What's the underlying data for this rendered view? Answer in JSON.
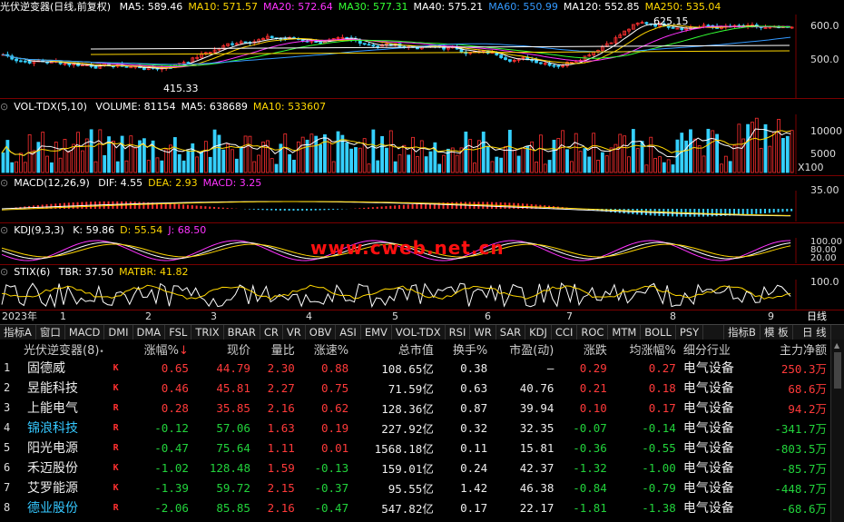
{
  "main_header": {
    "title": "光伏逆变器(日线,前复权)",
    "ma": [
      {
        "label": "MA5: 589.46",
        "color": "#ffffff"
      },
      {
        "label": "MA10: 571.57",
        "color": "#ffd700"
      },
      {
        "label": "MA20: 572.64",
        "color": "#ff33ff"
      },
      {
        "label": "MA30: 577.31",
        "color": "#33ff33"
      },
      {
        "label": "MA40: 575.21",
        "color": "#ffffff"
      },
      {
        "label": "MA60: 550.99",
        "color": "#3399ff"
      },
      {
        "label": "MA120: 552.85",
        "color": "#ffffff"
      },
      {
        "label": "MA250: 535.04",
        "color": "#ffd700"
      }
    ],
    "high_label": "625.15",
    "low_label": "415.33",
    "y_ticks": [
      "600.0",
      "500.0"
    ]
  },
  "vol_header": {
    "title": "VOL-TDX(5,10)",
    "items": [
      {
        "label": "VOLUME: 81154",
        "color": "#ffffff"
      },
      {
        "label": "MA5: 638689",
        "color": "#ffffff"
      },
      {
        "label": "MA10: 533607",
        "color": "#ffd700"
      }
    ],
    "y_ticks": [
      "10000",
      "5000",
      "X100"
    ]
  },
  "macd_header": {
    "title": "MACD(12,26,9)",
    "items": [
      {
        "label": "DIF: 4.55",
        "color": "#ffffff"
      },
      {
        "label": "DEA: 2.93",
        "color": "#ffd700"
      },
      {
        "label": "MACD: 3.25",
        "color": "#ff33ff"
      }
    ],
    "y_ticks": [
      "35.00"
    ]
  },
  "kdj_header": {
    "title": "KDJ(9,3,3)",
    "items": [
      {
        "label": "K: 59.86",
        "color": "#ffffff"
      },
      {
        "label": "D: 55.54",
        "color": "#ffd700"
      },
      {
        "label": "J: 68.50",
        "color": "#ff33ff"
      }
    ],
    "y_ticks": [
      "100.00",
      "80.00",
      "20.00"
    ]
  },
  "stix_header": {
    "title": "STIX(6)",
    "items": [
      {
        "label": "TBR: 37.50",
        "color": "#ffffff"
      },
      {
        "label": "MATBR: 41.82",
        "color": "#ffd700"
      }
    ],
    "y_ticks": [
      "100.0"
    ]
  },
  "timeline": {
    "year": "2023年",
    "months": [
      "1",
      "2",
      "3",
      "4",
      "5",
      "6",
      "7",
      "8",
      "9"
    ],
    "period_label": "日线"
  },
  "watermark": "www.cweb.net.cn",
  "indicator_tabs": [
    "指标A",
    "窗口",
    "MACD",
    "DMI",
    "DMA",
    "FSL",
    "TRIX",
    "BRAR",
    "CR",
    "VR",
    "OBV",
    "ASI",
    "EMV",
    "VOL-TDX",
    "RSI",
    "WR",
    "SAR",
    "KDJ",
    "CCI",
    "ROC",
    "MTM",
    "BOLL",
    "PSY"
  ],
  "indicator_right": [
    "指标B",
    "模 板",
    "日 线"
  ],
  "table": {
    "title": "光伏逆变器(8)",
    "headers": [
      "涨幅%",
      "现价",
      "量比",
      "涨速%",
      "总市值",
      "换手%",
      "市盈(动)",
      "涨跌",
      "均涨幅%",
      "细分行业",
      "主力净额"
    ],
    "rows": [
      {
        "idx": "1",
        "name": "固德威",
        "flag": "K",
        "name_color": "#eeeeee",
        "cols": [
          "0.65",
          "44.79",
          "2.30",
          "0.88",
          "108.65亿",
          "0.38",
          "–",
          "0.29",
          "0.27",
          "电气设备",
          "250.3万"
        ],
        "colors": [
          "red",
          "red",
          "red",
          "red",
          "white",
          "white",
          "white",
          "red",
          "red",
          "white",
          "red"
        ]
      },
      {
        "idx": "2",
        "name": "昱能科技",
        "flag": "K",
        "name_color": "#eeeeee",
        "cols": [
          "0.46",
          "45.81",
          "2.27",
          "0.75",
          "71.59亿",
          "0.63",
          "40.76",
          "0.21",
          "0.18",
          "电气设备",
          "68.6万"
        ],
        "colors": [
          "red",
          "red",
          "red",
          "red",
          "white",
          "white",
          "white",
          "red",
          "red",
          "white",
          "red"
        ]
      },
      {
        "idx": "3",
        "name": "上能电气",
        "flag": "R",
        "name_color": "#eeeeee",
        "cols": [
          "0.28",
          "35.85",
          "2.16",
          "0.62",
          "128.36亿",
          "0.87",
          "39.94",
          "0.10",
          "0.17",
          "电气设备",
          "94.2万"
        ],
        "colors": [
          "red",
          "red",
          "red",
          "red",
          "white",
          "white",
          "white",
          "red",
          "red",
          "white",
          "red"
        ]
      },
      {
        "idx": "4",
        "name": "锦浪科技",
        "flag": "R",
        "name_color": "#35c8ff",
        "cols": [
          "-0.12",
          "57.06",
          "1.63",
          "0.19",
          "227.92亿",
          "0.32",
          "32.35",
          "-0.07",
          "-0.14",
          "电气设备",
          "-341.7万"
        ],
        "colors": [
          "green",
          "green",
          "red",
          "red",
          "white",
          "white",
          "white",
          "green",
          "green",
          "white",
          "green"
        ]
      },
      {
        "idx": "5",
        "name": "阳光电源",
        "flag": "R",
        "name_color": "#eeeeee",
        "cols": [
          "-0.47",
          "75.64",
          "1.11",
          "0.01",
          "1568.18亿",
          "0.11",
          "15.81",
          "-0.36",
          "-0.55",
          "电气设备",
          "-803.5万"
        ],
        "colors": [
          "green",
          "green",
          "red",
          "red",
          "white",
          "white",
          "white",
          "green",
          "green",
          "white",
          "green"
        ]
      },
      {
        "idx": "6",
        "name": "禾迈股份",
        "flag": "K",
        "name_color": "#eeeeee",
        "cols": [
          "-1.02",
          "128.48",
          "1.59",
          "-0.13",
          "159.01亿",
          "0.24",
          "42.37",
          "-1.32",
          "-1.00",
          "电气设备",
          "-85.7万"
        ],
        "colors": [
          "green",
          "green",
          "red",
          "green",
          "white",
          "white",
          "white",
          "green",
          "green",
          "white",
          "green"
        ]
      },
      {
        "idx": "7",
        "name": "艾罗能源",
        "flag": "K",
        "name_color": "#eeeeee",
        "cols": [
          "-1.39",
          "59.72",
          "2.15",
          "-0.37",
          "95.55亿",
          "1.42",
          "46.38",
          "-0.84",
          "-0.79",
          "电气设备",
          "-448.7万"
        ],
        "colors": [
          "green",
          "green",
          "red",
          "green",
          "white",
          "white",
          "white",
          "green",
          "green",
          "white",
          "green"
        ]
      },
      {
        "idx": "8",
        "name": "德业股份",
        "flag": "R",
        "name_color": "#35c8ff",
        "cols": [
          "-2.06",
          "85.85",
          "2.16",
          "-0.47",
          "547.82亿",
          "0.17",
          "22.17",
          "-1.81",
          "-1.38",
          "电气设备",
          "-68.6万"
        ],
        "colors": [
          "green",
          "green",
          "red",
          "green",
          "white",
          "white",
          "white",
          "green",
          "green",
          "white",
          "green"
        ]
      }
    ]
  }
}
